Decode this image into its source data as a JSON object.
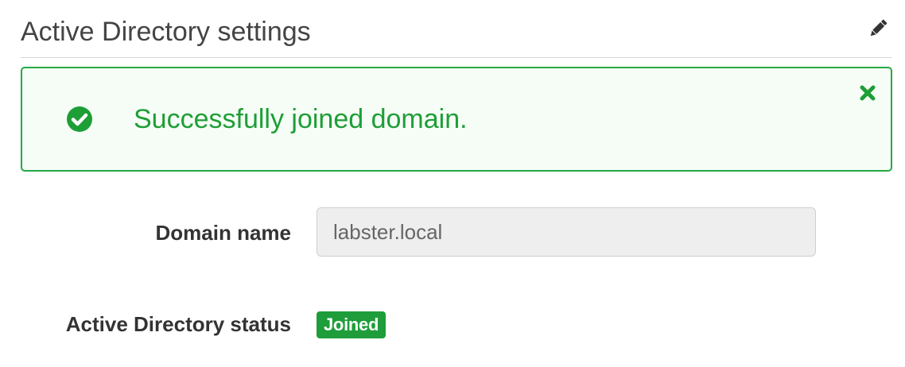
{
  "header": {
    "title": "Active Directory settings",
    "edit_icon": "pencil-icon"
  },
  "alert": {
    "icon": "check-circle-icon",
    "message": "Successfully joined domain.",
    "close_icon": "close-icon",
    "color": "#27a844"
  },
  "fields": {
    "domain_name": {
      "label": "Domain name",
      "value": "labster.local"
    },
    "ad_status": {
      "label": "Active Directory status",
      "badge": "Joined",
      "badge_color": "#1f9d3a"
    }
  }
}
